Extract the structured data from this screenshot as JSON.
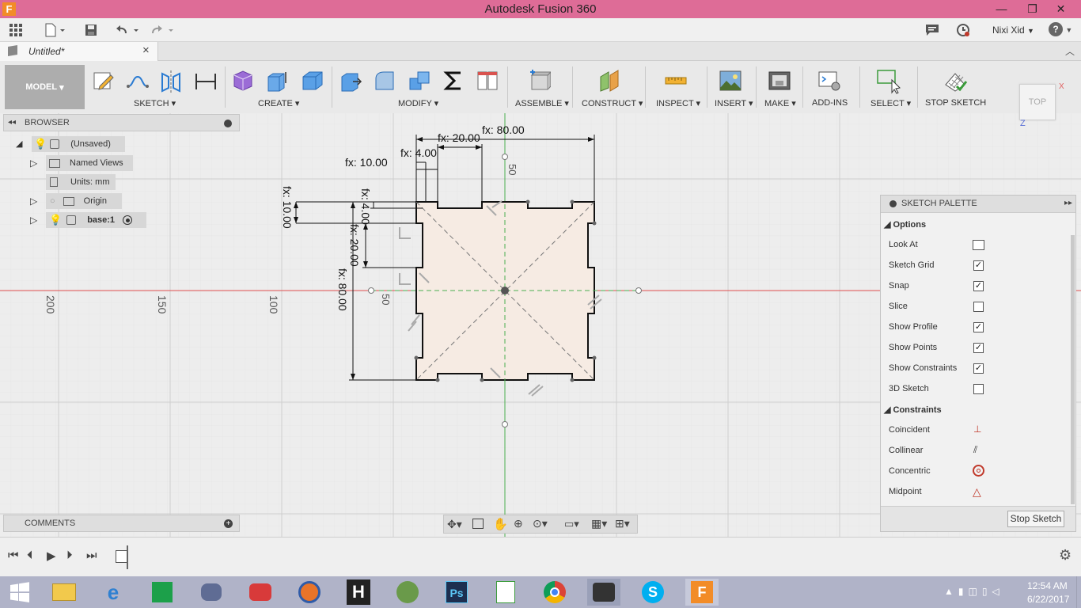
{
  "window": {
    "title": "Autodesk Fusion 360",
    "minimize": "—",
    "maximize": "❐",
    "close": "✕"
  },
  "appbar": {
    "user": "Nixi Xid",
    "help": "?"
  },
  "doc_tab": {
    "label": "Untitled*",
    "close": "×"
  },
  "toolbar": {
    "model_label": "MODEL",
    "groups": {
      "sketch": "SKETCH",
      "create": "CREATE",
      "modify": "MODIFY",
      "assemble": "ASSEMBLE",
      "construct": "CONSTRUCT",
      "inspect": "INSPECT",
      "insert": "INSERT",
      "make": "MAKE",
      "addins": "ADD-INS",
      "select": "SELECT",
      "stop_sketch": "STOP SKETCH"
    }
  },
  "viewcube": {
    "label": "TOP",
    "axis_z": "Z",
    "axis_x": "X"
  },
  "browser": {
    "title": "BROWSER",
    "items": [
      {
        "label": "(Unsaved)"
      },
      {
        "label": "Named Views"
      },
      {
        "label": "Units: mm"
      },
      {
        "label": "Origin"
      },
      {
        "label": "base:1"
      }
    ]
  },
  "comments": {
    "title": "COMMENTS"
  },
  "sketch": {
    "dims": {
      "d80_top": "fx: 80.00",
      "d20_top": "fx: 20.00",
      "d4_top": "fx: 4.00",
      "d10_top": "fx: 10.00",
      "d10_left": "fx: 10.00",
      "d4_left": "fx: 4.00",
      "d20_left": "fx: 20.00",
      "d80_left": "fx: 80.00"
    },
    "grid_labels": {
      "g200": "200",
      "g150": "150",
      "g100": "100",
      "g50h": "50",
      "g50v": "50"
    }
  },
  "palette": {
    "title": "SKETCH PALETTE",
    "options_title": "Options",
    "options": [
      {
        "label": "Look At",
        "type": "icon"
      },
      {
        "label": "Sketch Grid",
        "checked": true
      },
      {
        "label": "Snap",
        "checked": true
      },
      {
        "label": "Slice",
        "checked": false
      },
      {
        "label": "Show Profile",
        "checked": true
      },
      {
        "label": "Show Points",
        "checked": true
      },
      {
        "label": "Show Constraints",
        "checked": true
      },
      {
        "label": "3D Sketch",
        "checked": false
      }
    ],
    "constraints_title": "Constraints",
    "constraints": [
      {
        "label": "Coincident"
      },
      {
        "label": "Collinear"
      },
      {
        "label": "Concentric"
      },
      {
        "label": "Midpoint"
      }
    ],
    "stop_button": "Stop Sketch"
  },
  "taskbar": {
    "time": "12:54 AM",
    "date": "6/22/2017"
  },
  "colors": {
    "titlebar": "#de6c97",
    "accent_blue": "#2a7bd2",
    "profile_fill": "#f6ebe3"
  }
}
